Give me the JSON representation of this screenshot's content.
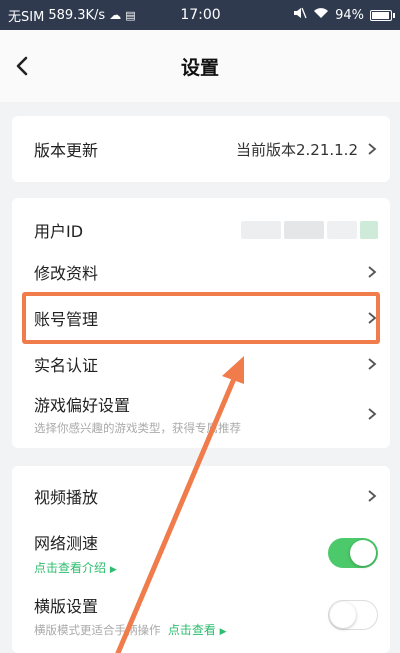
{
  "status_bar": {
    "carrier": "无SIM",
    "speed": "589.3K/s",
    "time": "17:00",
    "battery": "94%"
  },
  "header": {
    "title": "设置"
  },
  "version_section": {
    "label": "版本更新",
    "value": "当前版本2.21.1.2"
  },
  "account_section": {
    "items": [
      {
        "label": "用户ID"
      },
      {
        "label": "修改资料"
      },
      {
        "label": "账号管理"
      },
      {
        "label": "实名认证"
      },
      {
        "label": "游戏偏好设置",
        "sub": "选择你感兴趣的游戏类型，获得专属推荐"
      }
    ]
  },
  "media_section": {
    "video_label": "视频播放",
    "network": {
      "label": "网络测速",
      "link": "点击查看介绍",
      "enabled": true
    },
    "landscape": {
      "label": "横版设置",
      "sub": "横版模式更适合手柄操作",
      "link": "点击查看",
      "enabled": false
    }
  },
  "colors": {
    "accent_green": "#4cc96a",
    "highlight": "#f07b4b",
    "status_bar": "#2f3a4e"
  }
}
